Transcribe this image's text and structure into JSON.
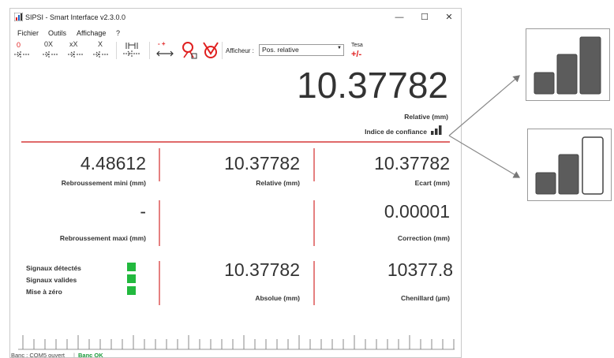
{
  "window": {
    "title": "SIPSI - Smart Interface v2.3.0.0",
    "minimize_glyph": "—",
    "maximize_glyph": "☐",
    "close_glyph": "✕"
  },
  "menu": {
    "items": [
      "Fichier",
      "Outils",
      "Affichage",
      "?"
    ]
  },
  "toolbar": {
    "zero_label": "0",
    "zero_x_label": "0X",
    "x_x_label": "xX",
    "x_label": "X",
    "afficheur_label": "Afficheur :",
    "afficheur_value": "Pos. relative",
    "tesa_label": "Tesa",
    "tesa_pm": "+/-",
    "minus_plus": "- +"
  },
  "display": {
    "main_value": "10.37782",
    "main_unit": "Relative (mm)",
    "confidence_label": "Indice de confiance",
    "confidence_level": 3
  },
  "grid": {
    "rebroussement_mini_value": "4.48612",
    "rebroussement_mini_label": "Rebroussement mini (mm)",
    "relative_value": "10.37782",
    "relative_label": "Relative (mm)",
    "ecart_value": "10.37782",
    "ecart_label": "Ecart (mm)",
    "rebroussement_maxi_value": "-",
    "rebroussement_maxi_label": "Rebroussement maxi (mm)",
    "correction_value": "0.00001",
    "correction_label": "Correction (mm)",
    "absolue_value": "10.37782",
    "absolue_label": "Absolue (mm)",
    "chenillard_value": "10377.8",
    "chenillard_label": "Chenillard (µm)"
  },
  "signals": {
    "items": [
      "Signaux détectés",
      "Signaux valides",
      "Mise à zéro"
    ],
    "color": "#22b93e"
  },
  "status": {
    "port": "Banc : COM5 ouvert",
    "banc": "Banc OK",
    "banc_color": "#1a9a3a"
  },
  "callouts": {
    "top_filled_bars": 3,
    "bottom_filled_bars": 2
  },
  "colors": {
    "separator": "#e06a6a",
    "accent_red": "#e02020"
  }
}
